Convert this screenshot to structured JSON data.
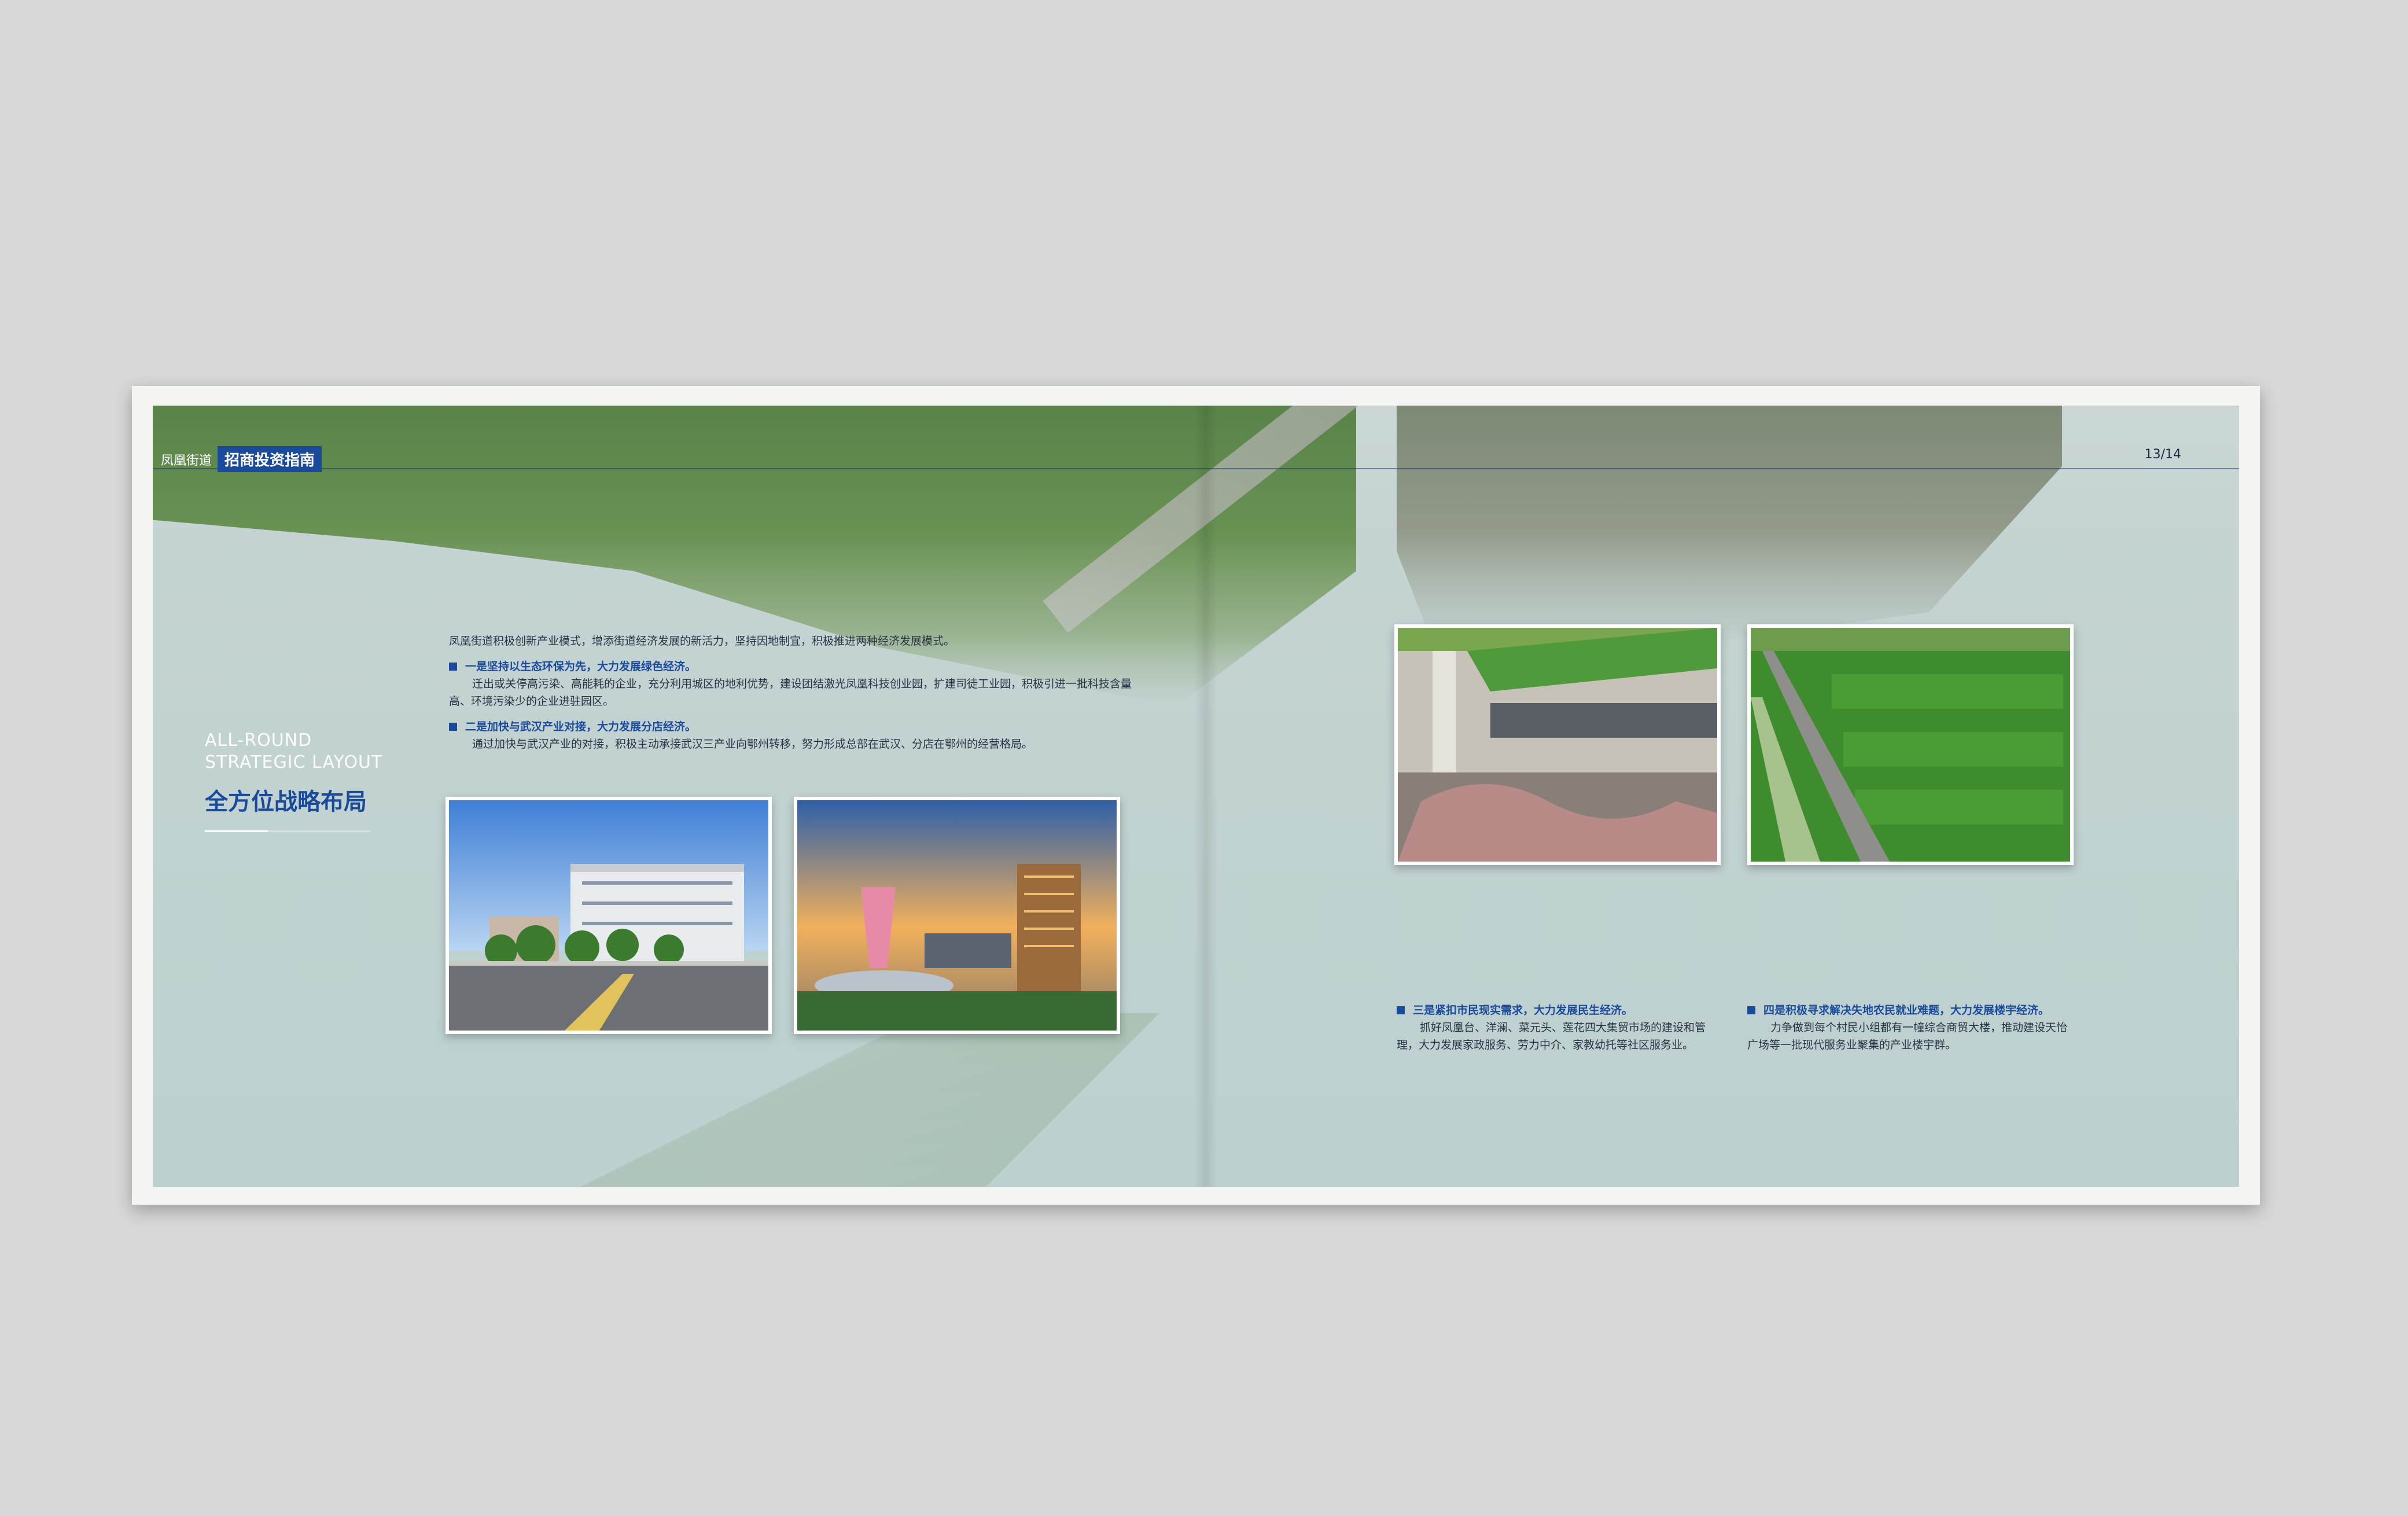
{
  "header": {
    "brand_small": "凤凰街道",
    "brand_tag": "招商投资指南",
    "page_number": "13/14"
  },
  "title": {
    "en_line1": "ALL-ROUND",
    "en_line2": "STRATEGIC LAYOUT",
    "zh": "全方位战略布局"
  },
  "intro": "凤凰街道积极创新产业模式，增添街道经济发展的新活力，坚持因地制宜，积极推进两种经济发展模式。",
  "items": [
    {
      "head": "一是坚持以生态环保为先，大力发展绿色经济。",
      "body": "迁出或关停高污染、高能耗的企业，充分利用城区的地利优势，建设团结激光凤凰科技创业园，扩建司徒工业园，积极引进一批科技含量高、环境污染少的企业进驻园区。"
    },
    {
      "head": "二是加快与武汉产业对接，大力发展分店经济。",
      "body": "通过加快与武汉产业的对接，积极主动承接武汉三产业向鄂州转移，努力形成总部在武汉、分店在鄂州的经营格局。"
    },
    {
      "head": "三是紧扣市民现实需求，大力发展民生经济。",
      "body": "抓好凤凰台、洋澜、菜元头、莲花四大集贸市场的建设和管理，大力发展家政服务、劳力中介、家教幼托等社区服务业。"
    },
    {
      "head": "四是积极寻求解决失地农民就业难题，大力发展楼宇经济。",
      "body": "力争做到每个村民小组都有一幢综合商贸大楼，推动建设天怡广场等一批现代服务业聚集的产业楼宇群。"
    }
  ],
  "colors": {
    "accent_blue": "#1a4a9c",
    "body_text": "#2a3346",
    "page_bg": "#d8d8d8"
  }
}
